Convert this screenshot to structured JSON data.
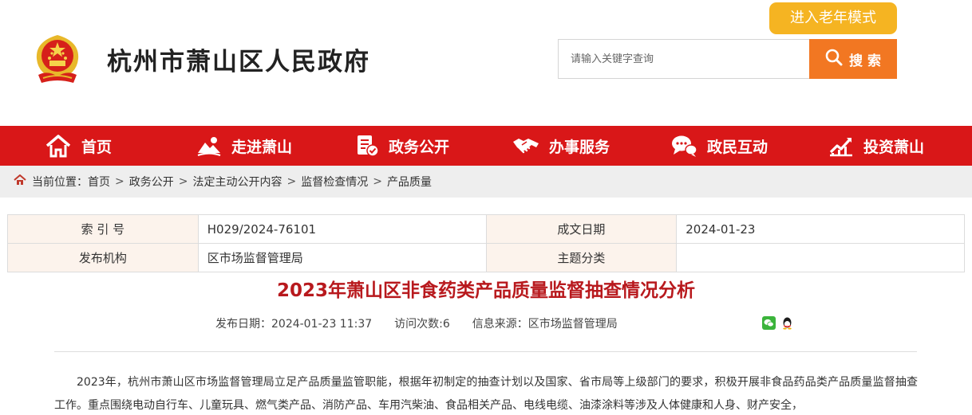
{
  "header": {
    "site_title": "杭州市萧山区人民政府",
    "elder_mode_label": "进入老年模式",
    "search_placeholder": "请输入关键字查询",
    "search_button_label": "搜 索"
  },
  "nav": {
    "items": [
      {
        "label": "首页",
        "icon": "home-icon"
      },
      {
        "label": "走进萧山",
        "icon": "landscape-icon"
      },
      {
        "label": "政务公开",
        "icon": "document-check-icon"
      },
      {
        "label": "办事服务",
        "icon": "handshake-icon"
      },
      {
        "label": "政民互动",
        "icon": "chat-bubbles-icon"
      },
      {
        "label": "投资萧山",
        "icon": "growth-chart-icon"
      }
    ]
  },
  "breadcrumb": {
    "prefix": "当前位置：",
    "items": [
      "首页",
      "政务公开",
      "法定主动公开内容",
      "监督检查情况",
      "产品质量"
    ],
    "separator": ">"
  },
  "info": {
    "index_label": "索 引 号",
    "index_value": "H029/2024-76101",
    "date_label": "成文日期",
    "date_value": "2024-01-23",
    "org_label": "发布机构",
    "org_value": "区市场监督管理局",
    "topic_label": "主题分类",
    "topic_value": ""
  },
  "article": {
    "title": "2023年萧山区非食药类产品质量监督抽查情况分析",
    "publish_date": "发布日期：2024-01-23 11:37",
    "visits": "访问次数:6",
    "source": "信息来源：区市场监督管理局",
    "body": "2023年，杭州市萧山区市场监督管理局立足产品质量监管职能，根据年初制定的抽查计划以及国家、省市局等上级部门的要求，积极开展非食品药品类产品质量监督抽查工作。重点围绕电动自行车、儿童玩具、燃气类产品、消防产品、车用汽柴油、食品相关产品、电线电缆、油漆涂料等涉及人体健康和人身、财产安全，"
  },
  "colors": {
    "nav_red": "#d91718",
    "title_red": "#b8191d",
    "search_orange": "#f27722",
    "elder_yellow": "#f5b422"
  }
}
